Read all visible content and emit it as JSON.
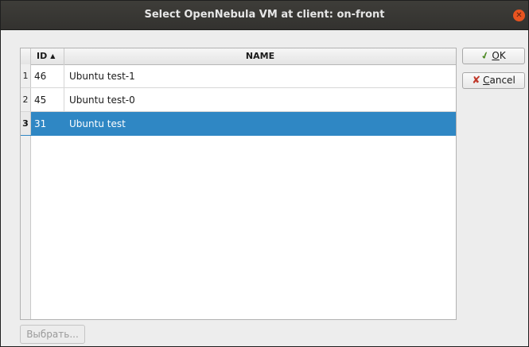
{
  "window": {
    "title": "Select OpenNebula VM at client: on-front",
    "close_icon": "close-icon"
  },
  "table": {
    "columns": [
      "ID",
      "NAME"
    ],
    "sort_column": "ID",
    "sort_direction": "ascending",
    "sort_icon": "▲",
    "rows": [
      {
        "num": "1",
        "id": "46",
        "name": "Ubuntu test-1",
        "selected": false
      },
      {
        "num": "2",
        "id": "45",
        "name": "Ubuntu test-0",
        "selected": false
      },
      {
        "num": "3",
        "id": "31",
        "name": "Ubuntu test",
        "selected": true
      }
    ]
  },
  "buttons": {
    "ok_mnemonic": "O",
    "ok_rest": "K",
    "cancel_mnemonic": "C",
    "cancel_rest": "ancel",
    "select_label": "Выбрать..."
  },
  "colors": {
    "selection": "#2f87c4",
    "close": "#e95420",
    "titlebar": "#3a3935"
  }
}
